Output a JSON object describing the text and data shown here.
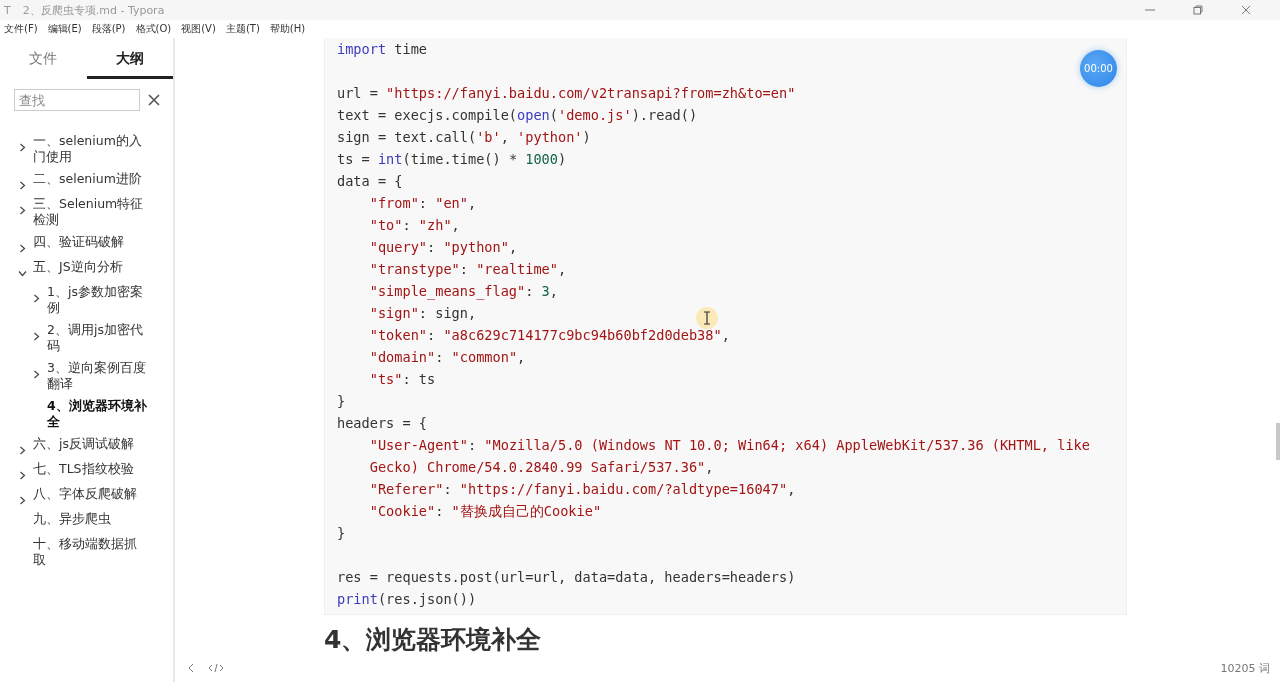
{
  "window": {
    "title": "2、反爬虫专项.md - Typora",
    "app_icon": "T"
  },
  "menu": [
    "文件(F)",
    "编辑(E)",
    "段落(P)",
    "格式(O)",
    "视图(V)",
    "主题(T)",
    "帮助(H)"
  ],
  "sidebar": {
    "tabs": [
      {
        "label": "文件",
        "selected": false
      },
      {
        "label": "大纲",
        "selected": true
      }
    ],
    "search": {
      "placeholder": "查找"
    },
    "outline": [
      {
        "label": "一、selenium的入门使用",
        "has_children": true,
        "expanded": false,
        "selected": false
      },
      {
        "label": "二、selenium进阶",
        "has_children": true,
        "expanded": false,
        "selected": false
      },
      {
        "label": "三、Selenium特征检测",
        "has_children": true,
        "expanded": false,
        "selected": false
      },
      {
        "label": "四、验证码破解",
        "has_children": true,
        "expanded": false,
        "selected": false
      },
      {
        "label": "五、JS逆向分析",
        "has_children": true,
        "expanded": true,
        "selected": false,
        "children": [
          {
            "label": "1、js参数加密案例",
            "has_children": true,
            "expanded": false,
            "selected": false
          },
          {
            "label": "2、调用js加密代码",
            "has_children": true,
            "expanded": false,
            "selected": false
          },
          {
            "label": "3、逆向案例百度翻译",
            "has_children": true,
            "expanded": false,
            "selected": false
          },
          {
            "label": "4、浏览器环境补全",
            "has_children": false,
            "selected": true
          }
        ]
      },
      {
        "label": "六、js反调试破解",
        "has_children": true,
        "expanded": false,
        "selected": false
      },
      {
        "label": "七、TLS指纹校验",
        "has_children": true,
        "expanded": false,
        "selected": false
      },
      {
        "label": "八、字体反爬破解",
        "has_children": true,
        "expanded": false,
        "selected": false
      },
      {
        "label": "九、异步爬虫",
        "has_children": false,
        "selected": false
      },
      {
        "label": "十、移动端数据抓取",
        "has_children": false,
        "selected": false
      }
    ]
  },
  "timer": "00:00",
  "code": [
    {
      "kind": "code",
      "indented": false,
      "tokens": [
        {
          "kind": "keyword",
          "text": "import"
        },
        {
          "kind": "plain",
          "text": " time"
        }
      ]
    },
    {
      "kind": "blank"
    },
    {
      "kind": "code",
      "indented": false,
      "tokens": [
        {
          "kind": "plain",
          "text": "url = "
        },
        {
          "kind": "string",
          "text": "\"https://fanyi.baidu.com/v2transapi?from=zh&to=en\""
        }
      ]
    },
    {
      "kind": "code",
      "indented": false,
      "tokens": [
        {
          "kind": "plain",
          "text": "text = execjs.compile("
        },
        {
          "kind": "builtin",
          "text": "open"
        },
        {
          "kind": "plain",
          "text": "("
        },
        {
          "kind": "string",
          "text": "'demo.js'"
        },
        {
          "kind": "plain",
          "text": ").read()"
        }
      ]
    },
    {
      "kind": "code",
      "indented": false,
      "tokens": [
        {
          "kind": "plain",
          "text": "sign = text.call("
        },
        {
          "kind": "string",
          "text": "'b'"
        },
        {
          "kind": "plain",
          "text": ", "
        },
        {
          "kind": "string",
          "text": "'python'"
        },
        {
          "kind": "plain",
          "text": ")"
        }
      ]
    },
    {
      "kind": "code",
      "indented": false,
      "tokens": [
        {
          "kind": "plain",
          "text": "ts = "
        },
        {
          "kind": "builtin",
          "text": "int"
        },
        {
          "kind": "plain",
          "text": "(time.time() * "
        },
        {
          "kind": "number",
          "text": "1000"
        },
        {
          "kind": "plain",
          "text": ")"
        }
      ]
    },
    {
      "kind": "code",
      "indented": false,
      "tokens": [
        {
          "kind": "plain",
          "text": "data = {"
        }
      ]
    },
    {
      "kind": "code",
      "indented": true,
      "tokens": [
        {
          "kind": "string",
          "text": "\"from\""
        },
        {
          "kind": "plain",
          "text": ": "
        },
        {
          "kind": "string",
          "text": "\"en\""
        },
        {
          "kind": "plain",
          "text": ","
        }
      ]
    },
    {
      "kind": "code",
      "indented": true,
      "tokens": [
        {
          "kind": "string",
          "text": "\"to\""
        },
        {
          "kind": "plain",
          "text": ": "
        },
        {
          "kind": "string",
          "text": "\"zh\""
        },
        {
          "kind": "plain",
          "text": ","
        }
      ]
    },
    {
      "kind": "code",
      "indented": true,
      "tokens": [
        {
          "kind": "string",
          "text": "\"query\""
        },
        {
          "kind": "plain",
          "text": ": "
        },
        {
          "kind": "string",
          "text": "\"python\""
        },
        {
          "kind": "plain",
          "text": ","
        }
      ]
    },
    {
      "kind": "code",
      "indented": true,
      "tokens": [
        {
          "kind": "string",
          "text": "\"transtype\""
        },
        {
          "kind": "plain",
          "text": ": "
        },
        {
          "kind": "string",
          "text": "\"realtime\""
        },
        {
          "kind": "plain",
          "text": ","
        }
      ]
    },
    {
      "kind": "code",
      "indented": true,
      "tokens": [
        {
          "kind": "string",
          "text": "\"simple_means_flag\""
        },
        {
          "kind": "plain",
          "text": ": "
        },
        {
          "kind": "number",
          "text": "3"
        },
        {
          "kind": "plain",
          "text": ","
        }
      ]
    },
    {
      "kind": "code",
      "indented": true,
      "tokens": [
        {
          "kind": "string",
          "text": "\"sign\""
        },
        {
          "kind": "plain",
          "text": ": sign,"
        }
      ]
    },
    {
      "kind": "code",
      "indented": true,
      "tokens": [
        {
          "kind": "string",
          "text": "\"token\""
        },
        {
          "kind": "plain",
          "text": ": "
        },
        {
          "kind": "string",
          "text": "\"a8c629c714177c9bc94b60bf2d0deb38\""
        },
        {
          "kind": "plain",
          "text": ","
        }
      ]
    },
    {
      "kind": "code",
      "indented": true,
      "tokens": [
        {
          "kind": "string",
          "text": "\"domain\""
        },
        {
          "kind": "plain",
          "text": ": "
        },
        {
          "kind": "string",
          "text": "\"common\""
        },
        {
          "kind": "plain",
          "text": ","
        }
      ]
    },
    {
      "kind": "code",
      "indented": true,
      "tokens": [
        {
          "kind": "string",
          "text": "\"ts\""
        },
        {
          "kind": "plain",
          "text": ": ts"
        }
      ]
    },
    {
      "kind": "code",
      "indented": false,
      "tokens": [
        {
          "kind": "plain",
          "text": "}"
        }
      ]
    },
    {
      "kind": "code",
      "indented": false,
      "tokens": [
        {
          "kind": "plain",
          "text": "headers = {"
        }
      ]
    },
    {
      "kind": "code",
      "indented": true,
      "tokens": [
        {
          "kind": "string",
          "text": "\"User-Agent\""
        },
        {
          "kind": "plain",
          "text": ": "
        },
        {
          "kind": "string",
          "text": "\"Mozilla/5.0 (Windows NT 10.0; Win64; x64) AppleWebKit/537.36 (KHTML, like Gecko) Chrome/54.0.2840.99 Safari/537.36\""
        },
        {
          "kind": "plain",
          "text": ","
        }
      ]
    },
    {
      "kind": "code",
      "indented": true,
      "tokens": [
        {
          "kind": "string",
          "text": "\"Referer\""
        },
        {
          "kind": "plain",
          "text": ": "
        },
        {
          "kind": "string",
          "text": "\"https://fanyi.baidu.com/?aldtype=16047\""
        },
        {
          "kind": "plain",
          "text": ","
        }
      ]
    },
    {
      "kind": "code",
      "indented": true,
      "tokens": [
        {
          "kind": "string",
          "text": "\"Cookie\""
        },
        {
          "kind": "plain",
          "text": ": "
        },
        {
          "kind": "string",
          "text": "\"替换成自己的Cookie\""
        }
      ]
    },
    {
      "kind": "code",
      "indented": false,
      "tokens": [
        {
          "kind": "plain",
          "text": "}"
        }
      ]
    },
    {
      "kind": "blank"
    },
    {
      "kind": "code",
      "indented": false,
      "tokens": [
        {
          "kind": "plain",
          "text": "res = requests.post(url=url, data=data, headers=headers)"
        }
      ]
    },
    {
      "kind": "code",
      "indented": false,
      "tokens": [
        {
          "kind": "builtin",
          "text": "print"
        },
        {
          "kind": "plain",
          "text": "(res.json())"
        }
      ]
    }
  ],
  "heading": "4、浏览器环境补全",
  "status_bar": {
    "word_count": "10205 词"
  }
}
